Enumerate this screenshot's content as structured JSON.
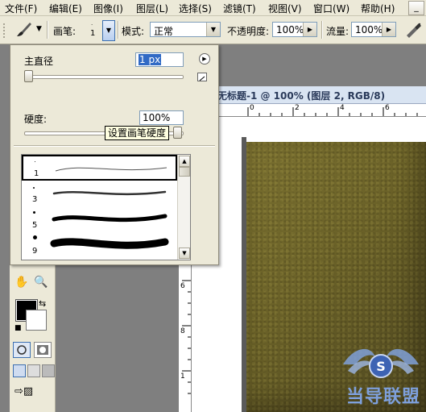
{
  "menu": {
    "items": [
      "文件(F)",
      "编辑(E)",
      "图像(I)",
      "图层(L)",
      "选择(S)",
      "滤镜(T)",
      "视图(V)",
      "窗口(W)",
      "帮助(H)"
    ]
  },
  "options_bar": {
    "brush_label": "画笔:",
    "brush_size": "1",
    "mode_label": "模式:",
    "mode_value": "正常",
    "opacity_label": "不透明度:",
    "opacity_value": "100%",
    "flow_label": "流量:",
    "flow_value": "100%",
    "icons": [
      "brush-tool-icon",
      "airbrush-icon"
    ]
  },
  "document": {
    "title": "无标题-1 @ 100% (图层 2, RGB/8)",
    "ruler_h_labels": [
      "0",
      "2",
      "4",
      "6"
    ],
    "ruler_v_labels": [
      "6",
      "8",
      "1"
    ]
  },
  "brush_popup": {
    "master_diameter_label": "主直径",
    "master_diameter_value": "1 px",
    "master_diameter_fraction": 0.0,
    "hardness_label": "硬度:",
    "hardness_value": "100%",
    "hardness_fraction": 1.0,
    "tooltip": "设置画笔硬度",
    "brushes": [
      {
        "size": "1"
      },
      {
        "size": "3"
      },
      {
        "size": "5"
      },
      {
        "size": "9"
      }
    ]
  },
  "colors": {
    "foreground": "#000000",
    "background": "#ffffff",
    "canvas_texture": "#6a6128"
  },
  "watermark": {
    "text": "当导联盟"
  }
}
